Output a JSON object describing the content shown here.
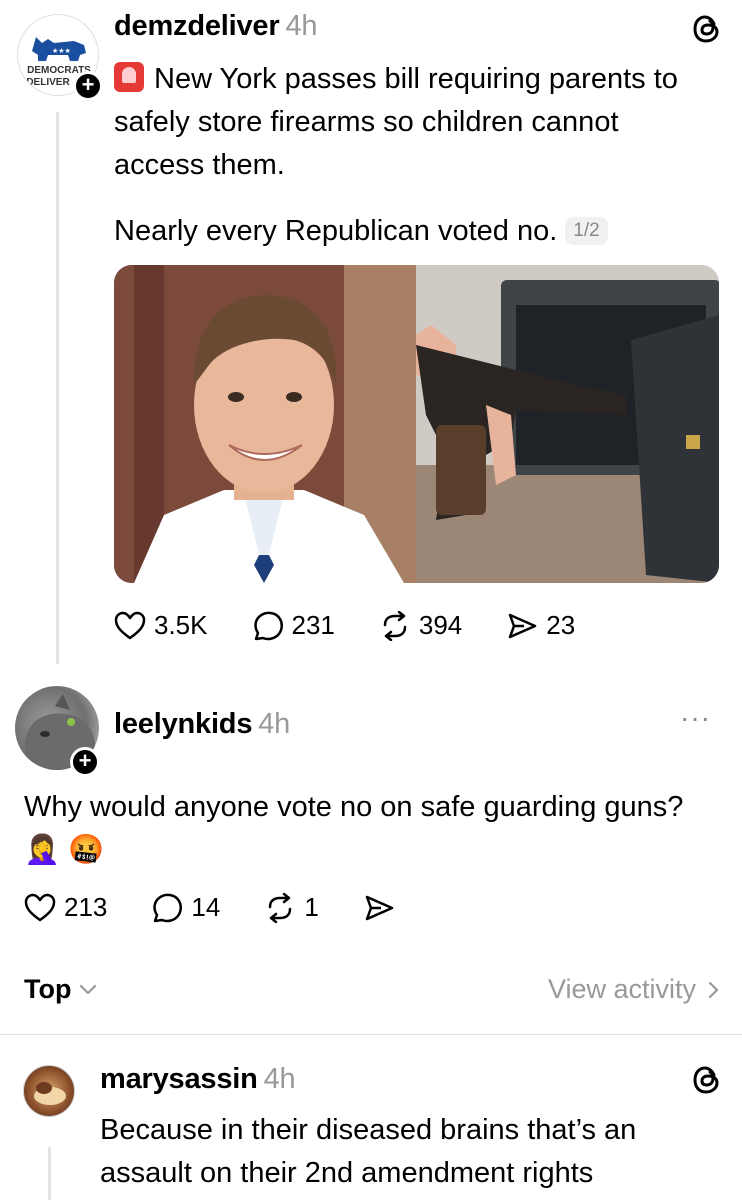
{
  "post1": {
    "username": "demzdeliver",
    "time": "4h",
    "avatar_text_line1": "DEMOCRATS",
    "avatar_text_line2": "DELIVER",
    "siren": "🚨",
    "text": "New York passes bill requiring parents to safely store firearms so children cannot access them.",
    "text2": "Nearly every Republican voted no.",
    "counter": "1/2",
    "likes": "3.5K",
    "replies": "231",
    "reposts": "394",
    "shares": "23",
    "icon": "threads-logo-icon"
  },
  "post2": {
    "username": "leelynkids",
    "time": "4h",
    "text": "Why would anyone vote no on safe guarding guns? 🤦‍♀️ 🤬",
    "likes": "213",
    "replies": "14",
    "reposts": "1",
    "menu": "···"
  },
  "sort": {
    "label": "Top",
    "view_activity": "View activity"
  },
  "post3": {
    "username": "marysassin",
    "time": "4h",
    "text": "Because in their diseased brains that’s an assault on their 2nd amendment rights",
    "icon": "threads-logo-icon"
  },
  "colors": {
    "secondary_text": "#999999",
    "divider": "#e0e0e0",
    "thread_line": "#e3e3e3",
    "democrat_blue": "#1a4fa0",
    "siren_red": "#e53935"
  }
}
